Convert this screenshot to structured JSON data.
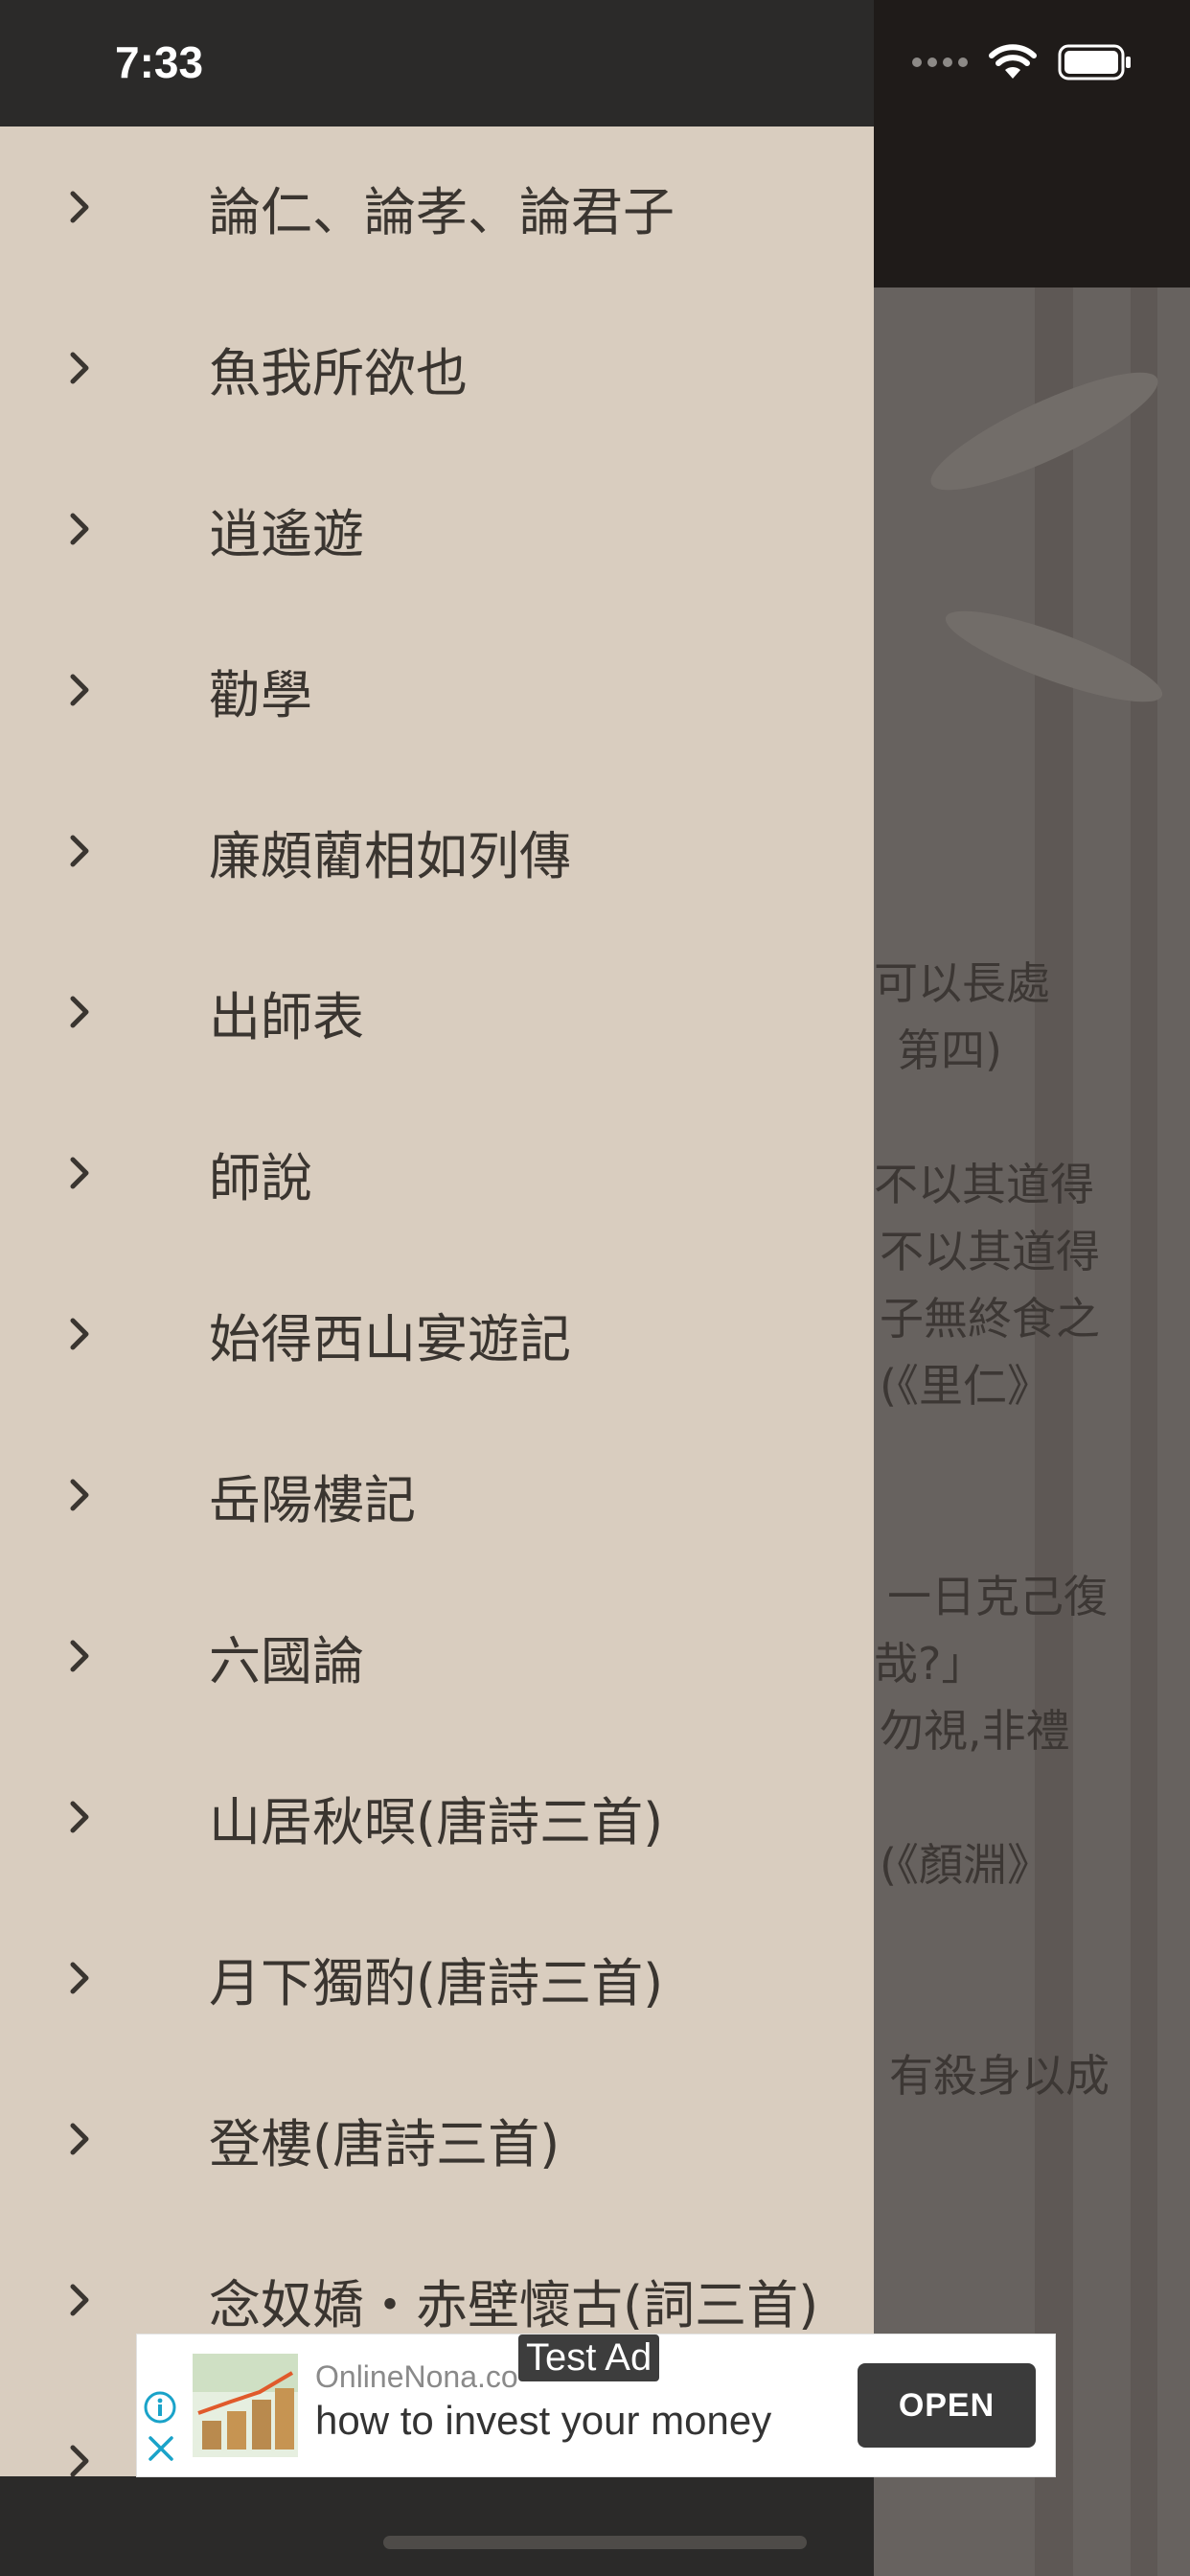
{
  "status_bar": {
    "time": "7:33"
  },
  "drawer": {
    "items": [
      {
        "label": "論仁、論孝、論君子"
      },
      {
        "label": "魚我所欲也"
      },
      {
        "label": "逍遙遊"
      },
      {
        "label": "勸學"
      },
      {
        "label": "廉頗藺相如列傳"
      },
      {
        "label": "出師表"
      },
      {
        "label": "師說"
      },
      {
        "label": "始得西山宴遊記"
      },
      {
        "label": "岳陽樓記"
      },
      {
        "label": "六國論"
      },
      {
        "label": "山居秋暝(唐詩三首)"
      },
      {
        "label": "月下獨酌(唐詩三首)"
      },
      {
        "label": "登樓(唐詩三首)"
      },
      {
        "label": "念奴嬌・赤壁懷古(詞三首)"
      },
      {
        "label": ""
      }
    ]
  },
  "background_text": {
    "lines": [
      "可以長處",
      "第四)",
      "不以其道得",
      "不以其道得",
      "子無終食之",
      "(《里仁》",
      "一日克己復",
      "哉?」",
      "勿視,非禮",
      "(《顏淵》",
      "有殺身以成"
    ]
  },
  "ad": {
    "label": "Test Ad",
    "domain": "OnlineNona.co",
    "headline": "how to invest your money",
    "cta": "OPEN"
  },
  "colors": {
    "drawer_bg": "#d9cdbf",
    "drawer_text": "#3a3530",
    "status_bar_bg": "#2b2a29",
    "ad_button": "#3b3b3b"
  }
}
